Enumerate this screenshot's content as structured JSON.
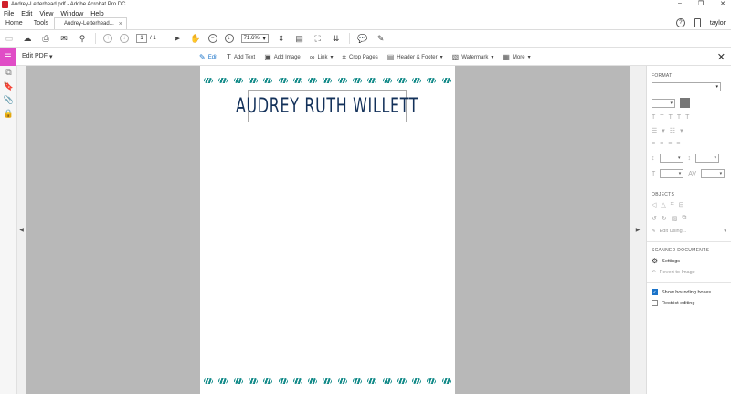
{
  "window": {
    "title": "Audrey-Letterhead.pdf - Adobe Acrobat Pro DC",
    "controls": [
      "–",
      "❐",
      "✕"
    ]
  },
  "menu": [
    "File",
    "Edit",
    "View",
    "Window",
    "Help"
  ],
  "tabs": {
    "home": "Home",
    "tools": "Tools",
    "doc": "Audrey-Letterhead...",
    "doc_close": "×"
  },
  "header_right": {
    "help": "?",
    "user": "taylor"
  },
  "toolbar": {
    "page_current": "1",
    "page_total": "/ 1",
    "zoom": "71.6%"
  },
  "editbar": {
    "label": "Edit PDF",
    "tools": [
      {
        "label": "Edit",
        "icon": "edit-icon",
        "active": true
      },
      {
        "label": "Add Text",
        "icon": "add-text-icon"
      },
      {
        "label": "Add Image",
        "icon": "add-image-icon"
      },
      {
        "label": "Link",
        "icon": "link-icon"
      },
      {
        "label": "Crop Pages",
        "icon": "crop-icon"
      },
      {
        "label": "Header & Footer",
        "icon": "header-footer-icon"
      },
      {
        "label": "Watermark",
        "icon": "watermark-icon"
      },
      {
        "label": "More",
        "icon": "more-icon"
      }
    ]
  },
  "document": {
    "name": "AUDREY RUTH WILLETT",
    "accent": "#128a88",
    "name_color": "#13315a"
  },
  "right_panel": {
    "format_heading": "FORMAT",
    "objects_heading": "OBJECTS",
    "edit_using": "Edit Using...",
    "scanned_heading": "SCANNED DOCUMENTS",
    "settings": "Settings",
    "revert": "Revert to Image",
    "show_bounding": "Show bounding boxes",
    "restrict": "Restrict editing"
  }
}
